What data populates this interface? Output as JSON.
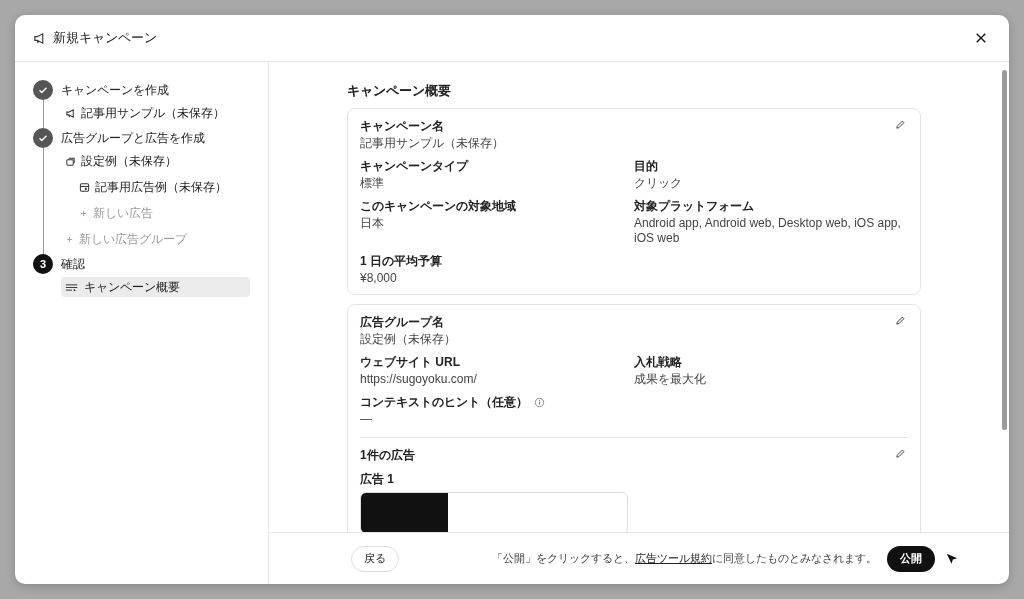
{
  "dialog": {
    "title": "新規キャンペーン"
  },
  "steps": [
    {
      "completed": true,
      "label": "キャンペーンを作成",
      "children": [
        {
          "kind": "campaign",
          "label": "記事用サンプル（未保存）",
          "selected": false
        }
      ]
    },
    {
      "completed": true,
      "label": "広告グループと広告を作成",
      "children": [
        {
          "kind": "adgroup",
          "label": "設定例（未保存）",
          "selected": false,
          "children": [
            {
              "kind": "ad",
              "label": "記事用広告例（未保存）",
              "selected": false
            },
            {
              "kind": "new",
              "label": "新しい広告",
              "selected": false
            }
          ]
        },
        {
          "kind": "new",
          "label": "新しい広告グループ",
          "selected": false
        }
      ]
    },
    {
      "completed": false,
      "number": "3",
      "label": "確認",
      "children": [
        {
          "kind": "summary",
          "label": "キャンペーン概要",
          "selected": true
        }
      ]
    }
  ],
  "summary": {
    "heading": "キャンペーン概要",
    "cards": [
      {
        "name_field": {
          "label": "キャンペーン名",
          "value": "記事用サンプル（未保存）"
        },
        "fields": [
          {
            "label": "キャンペーンタイプ",
            "value": "標準",
            "info": false
          },
          {
            "label": "目的",
            "value": "クリック",
            "info": false
          },
          {
            "label": "このキャンペーンの対象地域",
            "value": "日本",
            "info": false
          },
          {
            "label": "対象プラットフォーム",
            "value": "Android app, Android web, Desktop web, iOS app, iOS web",
            "info": false
          },
          {
            "label": "1 日の平均予算",
            "value": "¥8,000",
            "info": false
          }
        ]
      },
      {
        "name_field": {
          "label": "広告グループ名",
          "value": "設定例（未保存）"
        },
        "fields": [
          {
            "label": "ウェブサイト URL",
            "value": "https://sugoyoku.com/",
            "info": false
          },
          {
            "label": "入札戦略",
            "value": "成果を最大化",
            "info": false
          },
          {
            "label": "コンテキストのヒント（任意）",
            "value": "—",
            "info": true
          }
        ],
        "ads": {
          "title": "1件の広告",
          "items": [
            {
              "label": "広告 1"
            }
          ]
        }
      }
    ]
  },
  "footer": {
    "back": "戻る",
    "notice_before": "「公開」をクリックすると、",
    "notice_link": "広告ツール規約",
    "notice_after": "に同意したものとみなされます。",
    "publish": "公開"
  }
}
